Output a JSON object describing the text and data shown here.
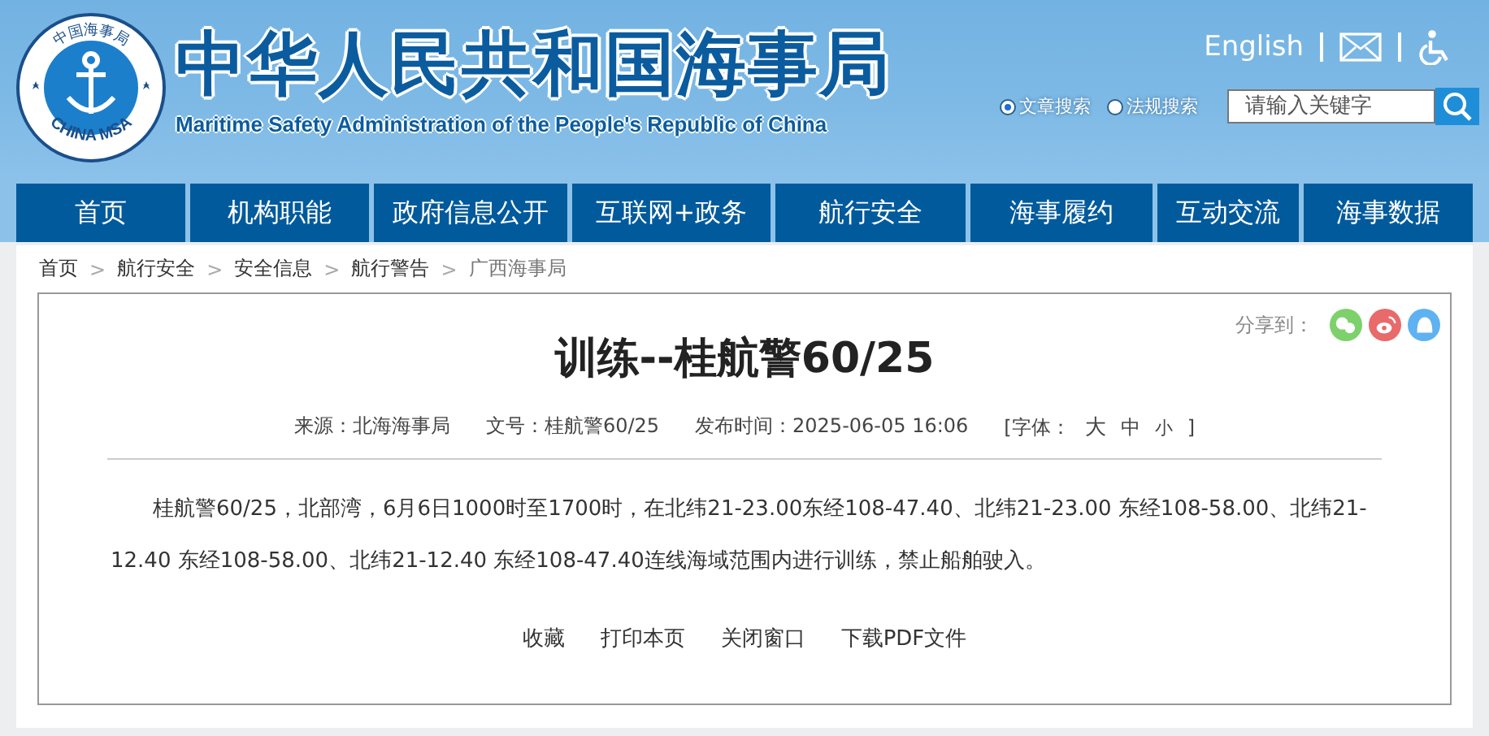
{
  "header": {
    "logo": {
      "top_text": "中国海事局",
      "bottom_text": "CHINA MSA"
    },
    "title": "中华人民共和国海事局",
    "subtitle": "Maritime Safety Administration of the People's Republic of China",
    "language_link": "English",
    "search": {
      "options": [
        {
          "label": "文章搜索",
          "selected": true
        },
        {
          "label": "法规搜索",
          "selected": false
        }
      ],
      "placeholder": "请输入关键字"
    }
  },
  "nav": [
    "首页",
    "机构职能",
    "政府信息公开",
    "互联网+政务",
    "航行安全",
    "海事履约",
    "互动交流",
    "海事数据"
  ],
  "breadcrumb": [
    "首页",
    "航行安全",
    "安全信息",
    "航行警告",
    "广西海事局"
  ],
  "breadcrumb_separator": ">",
  "article": {
    "share_label": "分享到：",
    "title": "训练--桂航警60/25",
    "meta": {
      "source": "来源：北海海事局",
      "number": "文号：桂航警60/25",
      "published": "发布时间：2025-06-05 16:06",
      "font_label": "[字体：",
      "font_sizes": [
        "大",
        "中",
        "小"
      ],
      "font_close": "]"
    },
    "body": "桂航警60/25，北部湾，6月6日1000时至1700时，在北纬21-23.00东经108-47.40、北纬21-23.00 东经108-58.00、北纬21-12.40 东经108-58.00、北纬21-12.40 东经108-47.40连线海域范围内进行训练，禁止船舶驶入。",
    "actions": [
      "收藏",
      "打印本页",
      "关闭窗口",
      "下载PDF文件"
    ]
  }
}
